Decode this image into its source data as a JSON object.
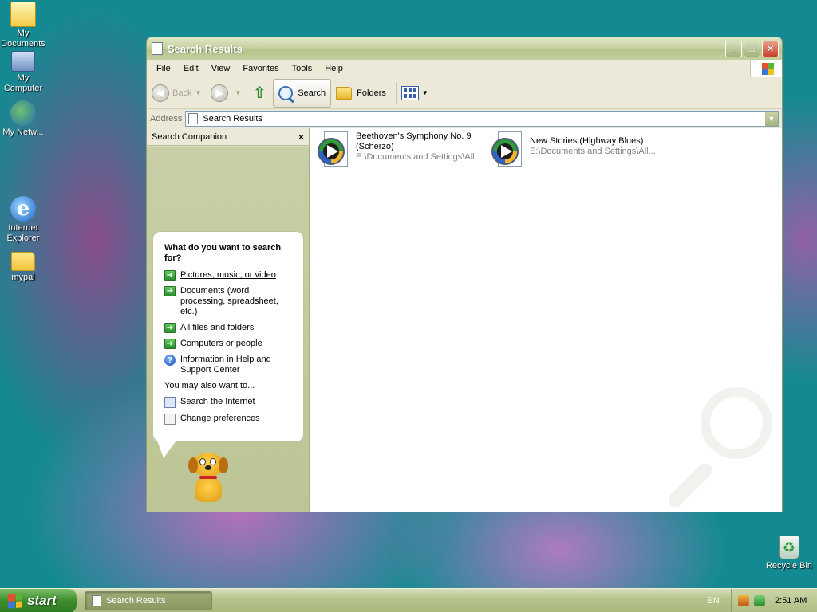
{
  "desktop": {
    "icons": [
      {
        "label": "My Documents"
      },
      {
        "label": "My Computer"
      },
      {
        "label": "My Netw..."
      },
      {
        "label": "Internet Explorer"
      },
      {
        "label": "mypal"
      },
      {
        "label": "Recycle Bin"
      }
    ]
  },
  "window": {
    "title": "Search Results",
    "menu": [
      "File",
      "Edit",
      "View",
      "Favorites",
      "Tools",
      "Help"
    ],
    "toolbar": {
      "back": "Back",
      "search": "Search",
      "folders": "Folders"
    },
    "address": {
      "label": "Address",
      "value": "Search Results"
    }
  },
  "companion": {
    "header": "Search Companion",
    "close": "×",
    "question": "What do you want to search for?",
    "options": [
      "Pictures, music, or video",
      "Documents (word processing, spreadsheet, etc.)",
      "All files and folders",
      "Computers or people",
      "Information in Help and Support Center"
    ],
    "also_label": "You may also want to...",
    "also": [
      "Search the Internet",
      "Change preferences"
    ]
  },
  "results": [
    {
      "name": "Beethoven's Symphony No. 9 (Scherzo)",
      "path": "E:\\Documents and Settings\\All..."
    },
    {
      "name": "New Stories (Highway Blues)",
      "path": "E:\\Documents and Settings\\All..."
    }
  ],
  "taskbar": {
    "start": "start",
    "task": "Search Results",
    "lang": "EN",
    "clock": "2:51 AM"
  },
  "colors": {
    "title_bar": "#b6c48c",
    "start_button": "#3c8d2c",
    "panel": "#bcc595"
  }
}
